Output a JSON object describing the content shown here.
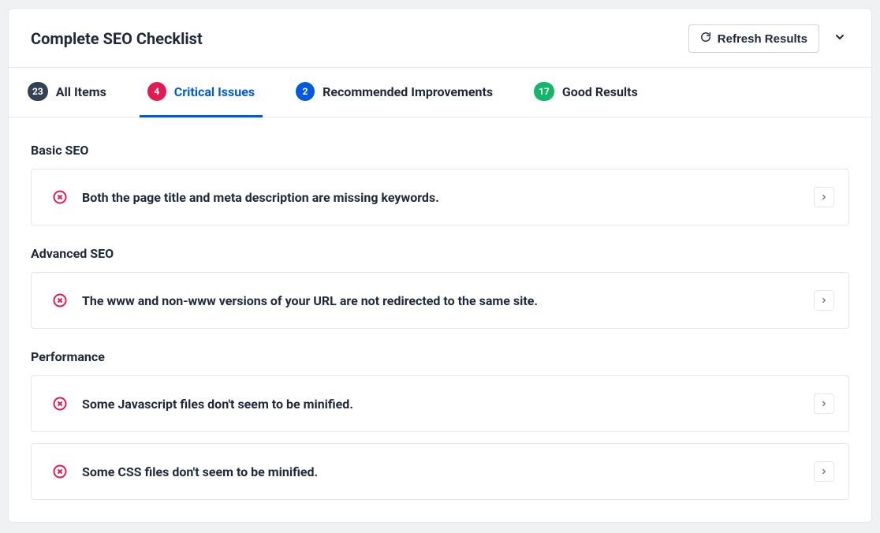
{
  "header": {
    "title": "Complete SEO Checklist",
    "refresh_label": "Refresh Results"
  },
  "tabs": [
    {
      "count": "23",
      "label": "All Items",
      "color": "gray",
      "active": false
    },
    {
      "count": "4",
      "label": "Critical Issues",
      "color": "red",
      "active": true
    },
    {
      "count": "2",
      "label": "Recommended Improvements",
      "color": "blue",
      "active": false
    },
    {
      "count": "17",
      "label": "Good Results",
      "color": "green",
      "active": false
    }
  ],
  "sections": [
    {
      "title": "Basic SEO",
      "items": [
        {
          "text": "Both the page title and meta description are missing keywords."
        }
      ]
    },
    {
      "title": "Advanced SEO",
      "items": [
        {
          "text": "The www and non-www versions of your URL are not redirected to the same site."
        }
      ]
    },
    {
      "title": "Performance",
      "items": [
        {
          "text": "Some Javascript files don't seem to be minified."
        },
        {
          "text": "Some CSS files don't seem to be minified."
        }
      ]
    }
  ]
}
